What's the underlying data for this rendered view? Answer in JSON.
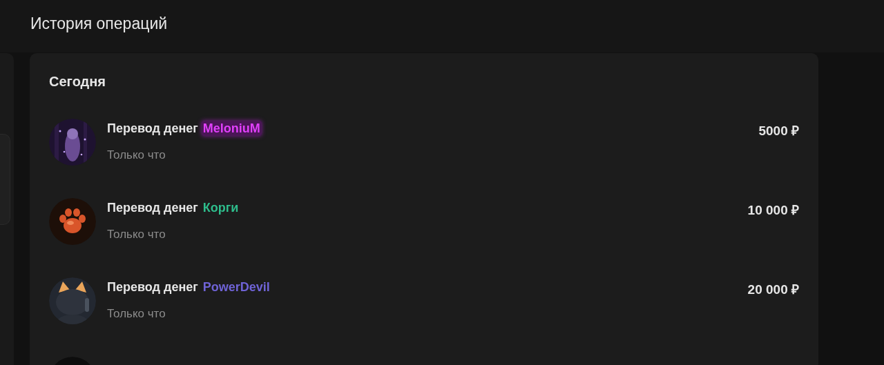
{
  "header": {
    "title": "История операций"
  },
  "section": {
    "title": "Сегодня",
    "operations": [
      {
        "avatar": {
          "kind": "picture"
        },
        "label": "Перевод денег",
        "name": "MeloniuM",
        "color": "#e040fb",
        "glow": true,
        "time": "Только что",
        "amount": "5000 ₽"
      },
      {
        "avatar": {
          "kind": "picture"
        },
        "label": "Перевод денег",
        "name": "Корги",
        "color": "#2ebd8c",
        "glow": false,
        "time": "Только что",
        "amount": "10 000 ₽"
      },
      {
        "avatar": {
          "kind": "picture"
        },
        "label": "Перевод денег",
        "name": "PowerDevil",
        "color": "#6f63d6",
        "glow": false,
        "time": "Только что",
        "amount": "20 000 ₽"
      },
      {
        "avatar": {
          "kind": "picture"
        }
      }
    ]
  }
}
